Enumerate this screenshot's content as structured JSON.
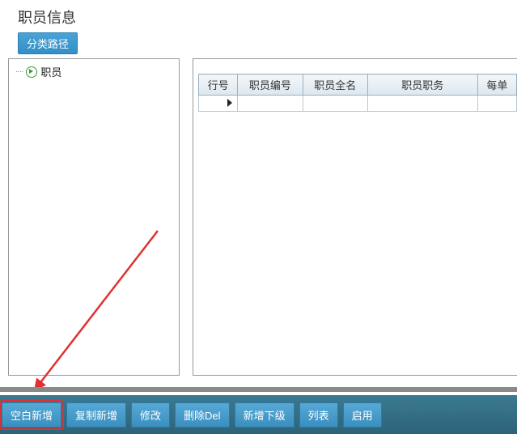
{
  "header": {
    "title": "职员信息",
    "path_button": "分类路径"
  },
  "tree": {
    "root_label": "职员"
  },
  "grid": {
    "columns": [
      "行号",
      "职员编号",
      "职员全名",
      "职员职务",
      "每单"
    ]
  },
  "toolbar": {
    "buttons": [
      {
        "key": "blank-new",
        "label": "空白新增",
        "highlighted": true
      },
      {
        "key": "copy-new",
        "label": "复制新增",
        "highlighted": false
      },
      {
        "key": "edit",
        "label": "修改",
        "highlighted": false
      },
      {
        "key": "delete",
        "label": "删除Del",
        "highlighted": false
      },
      {
        "key": "new-sub",
        "label": "新增下级",
        "highlighted": false
      },
      {
        "key": "list",
        "label": "列表",
        "highlighted": false
      },
      {
        "key": "enable",
        "label": "启用",
        "highlighted": false
      }
    ]
  }
}
